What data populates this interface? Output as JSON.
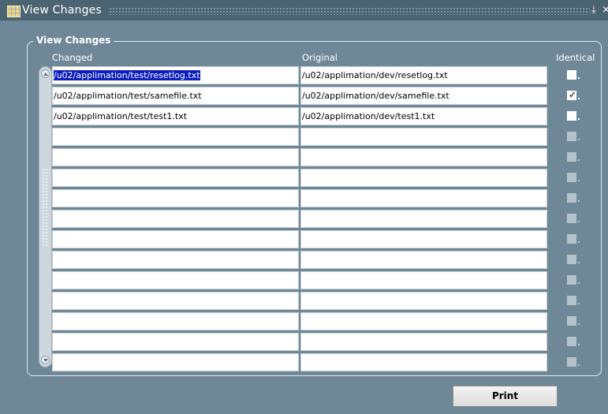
{
  "window": {
    "title": "View Changes"
  },
  "group": {
    "title": "View Changes"
  },
  "columns": {
    "changed": "Changed",
    "original": "Original",
    "identical": "Identical"
  },
  "rows": [
    {
      "changed": "/u02/applimation/test/resetlog.txt",
      "original": "/u02/applimation/dev/resetlog.txt",
      "identical": false,
      "selected": true
    },
    {
      "changed": "/u02/applimation/test/samefile.txt",
      "original": "/u02/applimation/dev/samefile.txt",
      "identical": true,
      "selected": false
    },
    {
      "changed": "/u02/applimation/test/test1.txt",
      "original": "/u02/applimation/dev/test1.txt",
      "identical": false,
      "selected": false
    },
    {
      "changed": "",
      "original": "",
      "identical": false,
      "selected": false
    },
    {
      "changed": "",
      "original": "",
      "identical": false,
      "selected": false
    },
    {
      "changed": "",
      "original": "",
      "identical": false,
      "selected": false
    },
    {
      "changed": "",
      "original": "",
      "identical": false,
      "selected": false
    },
    {
      "changed": "",
      "original": "",
      "identical": false,
      "selected": false
    },
    {
      "changed": "",
      "original": "",
      "identical": false,
      "selected": false
    },
    {
      "changed": "",
      "original": "",
      "identical": false,
      "selected": false
    },
    {
      "changed": "",
      "original": "",
      "identical": false,
      "selected": false
    },
    {
      "changed": "",
      "original": "",
      "identical": false,
      "selected": false
    },
    {
      "changed": "",
      "original": "",
      "identical": false,
      "selected": false
    },
    {
      "changed": "",
      "original": "",
      "identical": false,
      "selected": false
    },
    {
      "changed": "",
      "original": "",
      "identical": false,
      "selected": false
    }
  ],
  "buttons": {
    "print": "Print"
  },
  "icons": {
    "window": "grid-icon",
    "minimize": "minimize-icon",
    "close": "close-icon",
    "checkmark": "checkmark-icon"
  },
  "colors": {
    "background": "#6f8897",
    "titlebar": "#4b6472",
    "selection": "#0a1dc0"
  }
}
